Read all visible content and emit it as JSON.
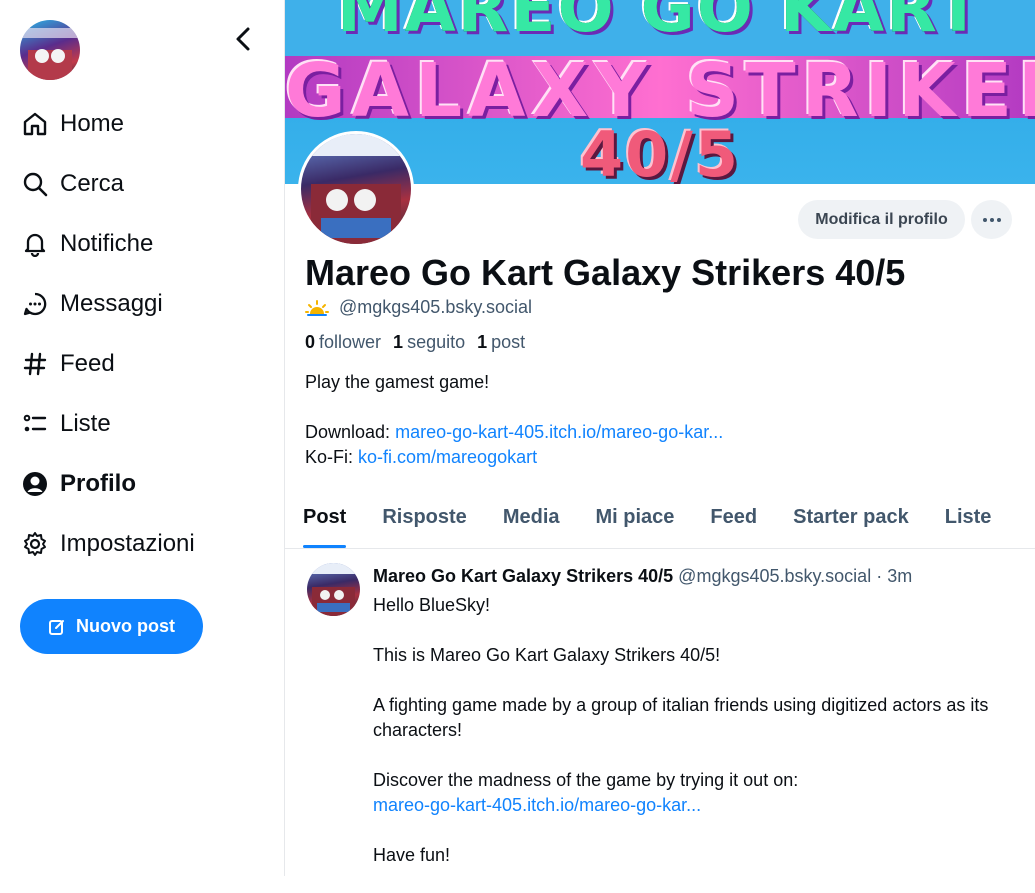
{
  "sidebar": {
    "items": [
      {
        "label": "Home",
        "icon": "home-icon"
      },
      {
        "label": "Cerca",
        "icon": "search-icon"
      },
      {
        "label": "Notifiche",
        "icon": "bell-icon"
      },
      {
        "label": "Messaggi",
        "icon": "chat-bubble-icon"
      },
      {
        "label": "Feed",
        "icon": "hashtag-icon"
      },
      {
        "label": "Liste",
        "icon": "list-icon"
      },
      {
        "label": "Profilo",
        "icon": "person-circle-icon",
        "active": true
      },
      {
        "label": "Impostazioni",
        "icon": "gear-icon"
      }
    ],
    "new_post_label": "Nuovo post"
  },
  "banner": {
    "line1": "MAREO GO KART",
    "line2": "GALAXY STRIKERS",
    "line3": "40/5"
  },
  "profile": {
    "edit_label": "Modifica il profilo",
    "display_name": "Mareo Go Kart Galaxy Strikers 40/5",
    "handle": "@mgkgs405.bsky.social",
    "stats": {
      "followers_count": "0",
      "followers_label": "follower",
      "following_count": "1",
      "following_label": "seguito",
      "posts_count": "1",
      "posts_label": "post"
    },
    "bio_line1": "Play the gamest game!",
    "download_label": "Download:",
    "download_link": "mareo-go-kart-405.itch.io/mareo-go-kar...",
    "kofi_label": "Ko-Fi:",
    "kofi_link": "ko-fi.com/mareogokart"
  },
  "tabs": [
    {
      "label": "Post",
      "active": true
    },
    {
      "label": "Risposte"
    },
    {
      "label": "Media"
    },
    {
      "label": "Mi piace"
    },
    {
      "label": "Feed"
    },
    {
      "label": "Starter pack"
    },
    {
      "label": "Liste"
    }
  ],
  "post": {
    "author": "Mareo Go Kart Galaxy Strikers 40/5",
    "handle": "@mgkgs405.bsky.social",
    "time": "· 3m",
    "p1": "Hello BlueSky!",
    "p2": "This is Mareo Go Kart Galaxy Strikers 40/5!",
    "p3": "A fighting game made by a group of italian friends using digitized actors as its characters!",
    "p4": "Discover the madness of the game by trying it out on:",
    "p4_link": "mareo-go-kart-405.itch.io/mareo-go-kar...",
    "p5": "Have fun!"
  },
  "colors": {
    "accent": "#1083fe",
    "muted": "#42576c",
    "text": "#0b0f14"
  }
}
